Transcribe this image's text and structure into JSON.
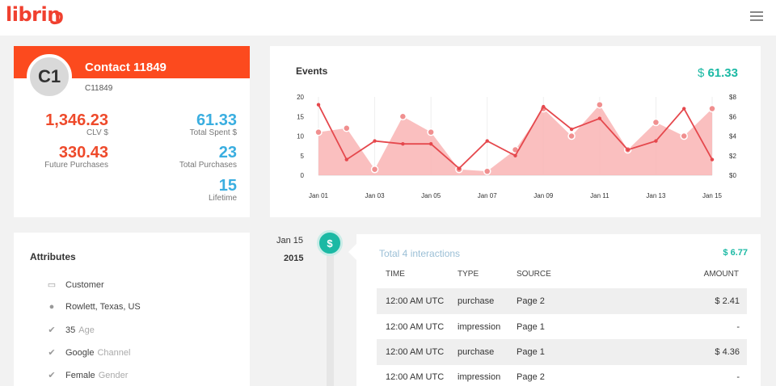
{
  "header": {
    "logo": "librinე",
    "menu_icon": "hamburger-icon"
  },
  "contact": {
    "avatar_initials": "C1",
    "name": "Contact 11849",
    "id": "C11849",
    "clv_value": "1,346.23",
    "clv_label": "CLV $",
    "total_spent_value": "61.33",
    "total_spent_label": "Total Spent $",
    "future_value": "330.43",
    "future_label": "Future Purchases",
    "total_purchases_value": "23",
    "total_purchases_label": "Total Purchases",
    "lifetime_value": "15",
    "lifetime_label": "Lifetime"
  },
  "events": {
    "title": "Events",
    "total_prefix": "$",
    "total_value": "61.33"
  },
  "chart_data": {
    "type": "line",
    "x": [
      "Jan 01",
      "Jan 02",
      "Jan 03",
      "Jan 04",
      "Jan 05",
      "Jan 06",
      "Jan 07",
      "Jan 08",
      "Jan 09",
      "Jan 10",
      "Jan 11",
      "Jan 12",
      "Jan 13",
      "Jan 14",
      "Jan 15"
    ],
    "x_tick_labels": [
      "Jan 01",
      "Jan 03",
      "Jan 05",
      "Jan 07",
      "Jan 09",
      "Jan 11",
      "Jan 13",
      "Jan 15"
    ],
    "left_axis": {
      "ticks": [
        "0",
        "5",
        "10",
        "15",
        "20"
      ],
      "ylim": [
        0,
        20
      ]
    },
    "right_axis": {
      "ticks": [
        "$0",
        "$2",
        "$4",
        "$6",
        "$8"
      ],
      "ylim": [
        0,
        8
      ]
    },
    "series": [
      {
        "axis": "left",
        "style": "area",
        "color": "#f9b4b4",
        "values": [
          11,
          12,
          1.5,
          15,
          11,
          1.5,
          1,
          6.5,
          17,
          10,
          18,
          6.5,
          13.5,
          10,
          17
        ]
      },
      {
        "axis": "right",
        "style": "line",
        "color": "#e5484d",
        "values": [
          7.2,
          1.6,
          3.5,
          3.2,
          3.2,
          0.7,
          3.5,
          2.0,
          7.0,
          4.7,
          5.8,
          2.6,
          3.5,
          6.8,
          1.6
        ]
      }
    ]
  },
  "attributes": {
    "title": "Attributes",
    "items": [
      {
        "icon": "money-icon",
        "glyph": "▭",
        "label": "Customer",
        "muted": ""
      },
      {
        "icon": "globe-icon",
        "glyph": "●",
        "label": "Rowlett, Texas, US",
        "muted": ""
      },
      {
        "icon": "check-icon",
        "glyph": "✔",
        "label": "35",
        "muted": "Age"
      },
      {
        "icon": "check-icon",
        "glyph": "✔",
        "label": "Google",
        "muted": "Channel"
      },
      {
        "icon": "check-icon",
        "glyph": "✔",
        "label": "Female",
        "muted": "Gender"
      }
    ]
  },
  "timeline": {
    "date": "Jan 15",
    "year": "2015",
    "icon_glyph": "$",
    "title": "Total 4 interactions",
    "amount": "$ 6.77",
    "columns": [
      "TIME",
      "TYPE",
      "SOURCE",
      "AMOUNT"
    ],
    "rows": [
      {
        "time": "12:00 AM UTC",
        "type": "purchase",
        "source": "Page 2",
        "amount": "$ 2.41"
      },
      {
        "time": "12:00 AM UTC",
        "type": "impression",
        "source": "Page 1",
        "amount": "-"
      },
      {
        "time": "12:00 AM UTC",
        "type": "purchase",
        "source": "Page 1",
        "amount": "$ 4.36"
      },
      {
        "time": "12:00 AM UTC",
        "type": "impression",
        "source": "Page 2",
        "amount": "-"
      }
    ]
  }
}
